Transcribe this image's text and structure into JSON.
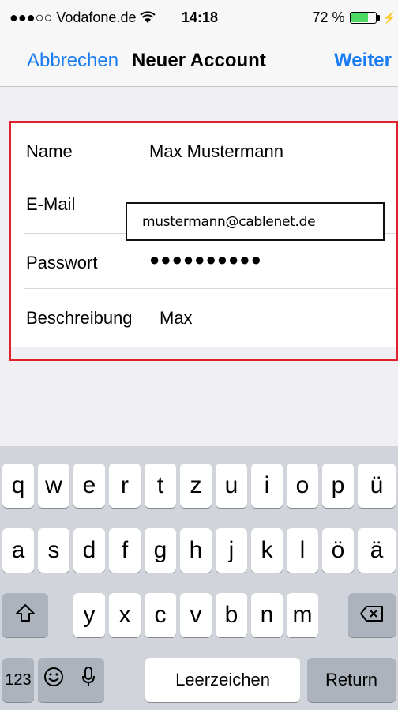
{
  "status_bar": {
    "signal_text": "●●●○○ Vodafone.de",
    "wifi_icon": "wifi-icon",
    "time": "14:18",
    "battery_percent": "72 %",
    "battery_level": 0.72,
    "battery_fill_color": "#4cd964",
    "charging_icon": "bolt-icon"
  },
  "nav": {
    "cancel_label": "Abbrechen",
    "title": "Neuer Account",
    "next_label": "Weiter",
    "accent_color": "#1a7cf2"
  },
  "form": {
    "rows": [
      {
        "label": "Name",
        "value": "Max Mustermann"
      },
      {
        "label": "E-Mail",
        "value": "mustermann@cablenet.de"
      },
      {
        "label": "Passwort",
        "value": "●●●●●●●●●●"
      },
      {
        "label": "Beschreibung",
        "value": "Max"
      }
    ],
    "highlight_color": "#e0202a"
  },
  "keyboard": {
    "row1": [
      "q",
      "w",
      "e",
      "r",
      "t",
      "z",
      "u",
      "i",
      "o",
      "p",
      "ü"
    ],
    "row2": [
      "a",
      "s",
      "d",
      "f",
      "g",
      "h",
      "j",
      "k",
      "l",
      "ö",
      "ä"
    ],
    "row3": [
      "y",
      "x",
      "c",
      "v",
      "b",
      "n",
      "m"
    ],
    "shift_icon": "shift-icon",
    "backspace_icon": "backspace-icon",
    "numbers_label": "123",
    "emoji_icon": "emoji-icon",
    "mic_icon": "microphone-icon",
    "space_label": "Leerzeichen",
    "return_label": "Return"
  }
}
